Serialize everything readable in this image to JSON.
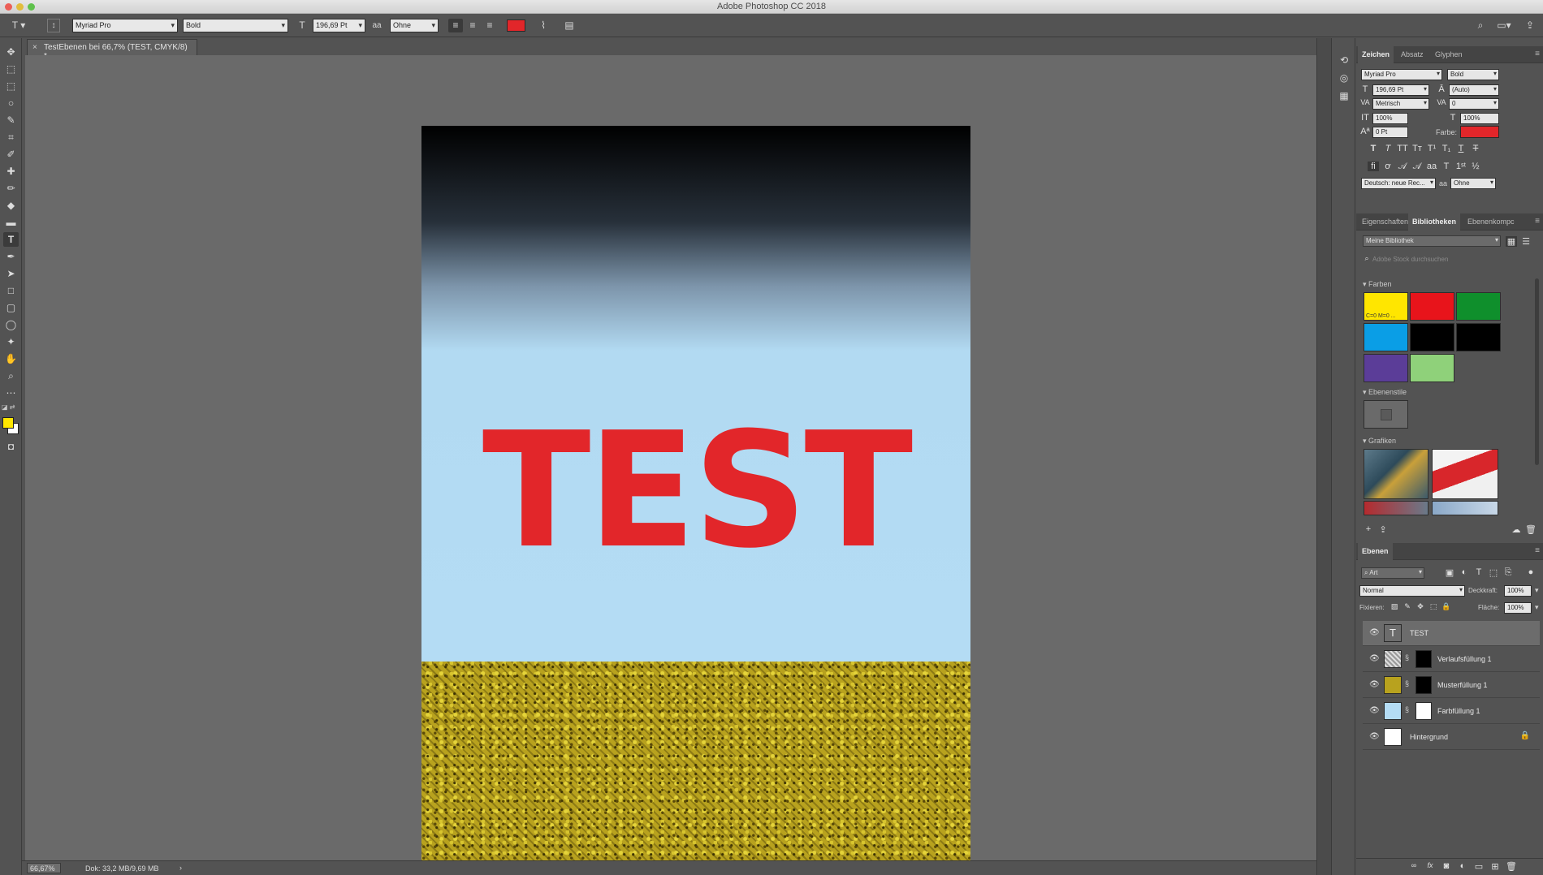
{
  "app": {
    "title": "Adobe Photoshop CC 2018",
    "colors": {
      "close": "#ec5f57",
      "minimize": "#e1bd3d",
      "maximize": "#5fc14c",
      "accent_text": "#e2262a"
    }
  },
  "options_bar": {
    "tool_icon": "T",
    "font_family": "Myriad Pro",
    "font_style": "Bold",
    "font_size": "196,69 Pt",
    "antialias_label": "a",
    "antialias": "Ohne"
  },
  "document": {
    "tab_close": "×",
    "tab_label": "TestEbenen bei 66,7% (TEST, CMYK/8) *",
    "canvas_text": "TEST"
  },
  "status": {
    "zoom": "66,67%",
    "doc_info": "Dok: 33,2 MB/9,69 MB",
    "arrow": "›"
  },
  "character_panel": {
    "tabs": [
      "Zeichen",
      "Absatz",
      "Glyphen"
    ],
    "font_family": "Myriad Pro",
    "font_style": "Bold",
    "size": "196,69 Pt",
    "leading": "(Auto)",
    "kerning": "Metrisch",
    "tracking": "0",
    "vertical_scale": "100%",
    "horizontal_scale": "100%",
    "baseline": "0 Pt",
    "color_label": "Farbe:",
    "language": "Deutsch: neue Rec...",
    "aa_label": "a",
    "antialias": "Ohne"
  },
  "libraries_panel": {
    "tabs": [
      "Eigenschaften",
      "Bibliotheken",
      "Ebenenkompc"
    ],
    "library": "Meine Bibliothek",
    "search_placeholder": "Adobe Stock durchsuchen",
    "colors_label": "Farben",
    "first_swatch_label": "C=0 M=0 ...",
    "swatches": [
      "#ffe600",
      "#e8141b",
      "#0f8f2c",
      "#0a9ee6",
      "#000000",
      "#000000",
      "#5b3d98",
      "#8fd17a"
    ],
    "styles_label": "Ebenenstile",
    "graphics_label": "Grafiken"
  },
  "layers_panel": {
    "tab": "Ebenen",
    "filter": "Art",
    "blend_mode": "Normal",
    "opacity_label": "Deckkraft:",
    "opacity": "100%",
    "lock_label": "Fixieren:",
    "fill_label": "Fläche:",
    "fill": "100%",
    "layers": [
      {
        "name": "TEST",
        "type": "text",
        "selected": true
      },
      {
        "name": "Verlaufsfüllung 1",
        "type": "gradient"
      },
      {
        "name": "Musterfüllung 1",
        "type": "pattern"
      },
      {
        "name": "Farbfüllung 1",
        "type": "color"
      },
      {
        "name": "Hintergrund",
        "type": "background",
        "locked": true
      }
    ]
  }
}
